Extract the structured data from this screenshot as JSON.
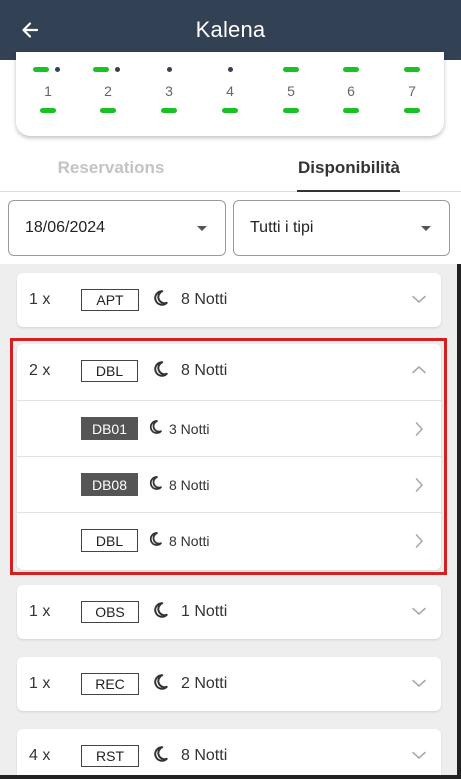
{
  "app_bar": {
    "title": "Kalena"
  },
  "calendar": {
    "days": [
      {
        "label": "1",
        "top_marks": [
          "bar",
          "dot"
        ],
        "bottom_mark": "bar"
      },
      {
        "label": "2",
        "top_marks": [
          "bar",
          "dot"
        ],
        "bottom_mark": "bar"
      },
      {
        "label": "3",
        "top_marks": [
          "dot"
        ],
        "bottom_mark": "bar"
      },
      {
        "label": "4",
        "top_marks": [
          "dot"
        ],
        "bottom_mark": "bar"
      },
      {
        "label": "5",
        "top_marks": [
          "bar"
        ],
        "bottom_mark": "bar"
      },
      {
        "label": "6",
        "top_marks": [
          "bar"
        ],
        "bottom_mark": "bar"
      },
      {
        "label": "7",
        "top_marks": [
          "bar"
        ],
        "bottom_mark": "bar"
      }
    ],
    "colors": {
      "bar": "#19c223",
      "dot": "#334155"
    }
  },
  "tabs": [
    {
      "label": "Reservations",
      "active": false
    },
    {
      "label": "Disponibilità",
      "active": true
    }
  ],
  "filters": {
    "date_value": "18/06/2024",
    "type_value": "Tutti i tipi"
  },
  "rooms": [
    {
      "qty": "1 x",
      "code": "APT",
      "nights": "8 Notti",
      "expanded": false
    },
    {
      "qty": "2 x",
      "code": "DBL",
      "nights": "8 Notti",
      "expanded": true,
      "units": [
        {
          "code": "DB01",
          "nights": "3 Notti",
          "dark": true
        },
        {
          "code": "DB08",
          "nights": "8 Notti",
          "dark": true
        },
        {
          "code": "DBL",
          "nights": "8 Notti",
          "dark": false
        }
      ]
    },
    {
      "qty": "1 x",
      "code": "OBS",
      "nights": "1 Notti",
      "expanded": false
    },
    {
      "qty": "1 x",
      "code": "REC",
      "nights": "2 Notti",
      "expanded": false
    },
    {
      "qty": "4 x",
      "code": "RST",
      "nights": "8 Notti",
      "expanded": false
    }
  ],
  "colors": {
    "app_bar": "#334155",
    "highlight": "#d42020"
  }
}
